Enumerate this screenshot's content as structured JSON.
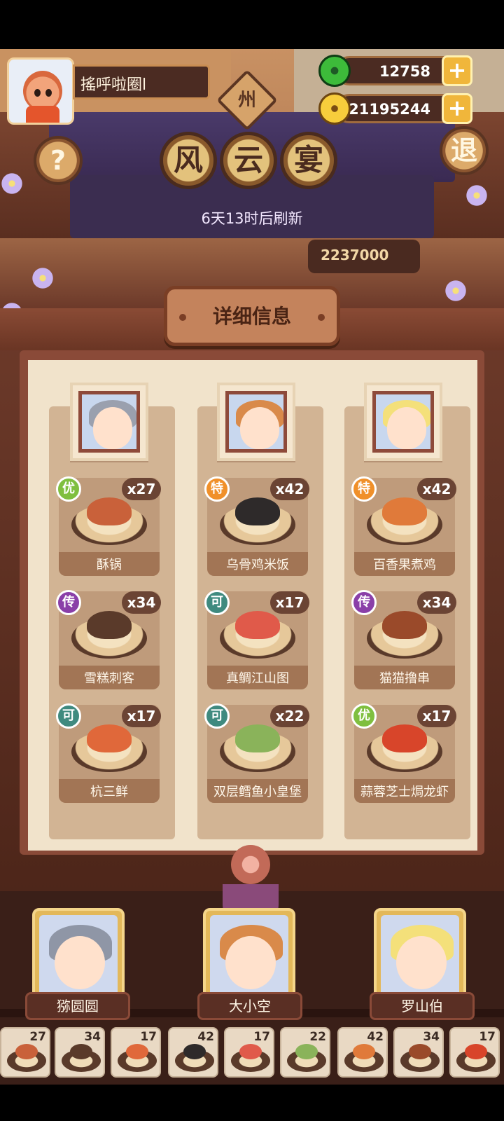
{
  "player": {
    "name": "搖呼啦圈l"
  },
  "region_badge": "州",
  "currencies": {
    "jade": {
      "value": "12758",
      "icon": "jade-icon"
    },
    "coin": {
      "value": "21195244",
      "icon": "coin-icon"
    }
  },
  "buttons": {
    "help": "?",
    "exit": "退",
    "add": "+"
  },
  "event": {
    "title_chars": [
      "风",
      "云",
      "宴"
    ],
    "refresh_text": "6天13时后刷新",
    "score": "2237000"
  },
  "detail_button": "详细信息",
  "columns": [
    {
      "chef": "猕圆圆",
      "dishes": [
        {
          "name": "酥锅",
          "grade": "优",
          "qty": "x27"
        },
        {
          "name": "雪糕刺客",
          "grade": "传",
          "qty": "x34"
        },
        {
          "name": "杭三鲜",
          "grade": "可",
          "qty": "x17"
        }
      ]
    },
    {
      "chef": "大小空",
      "dishes": [
        {
          "name": "乌骨鸡米饭",
          "grade": "特",
          "qty": "x42"
        },
        {
          "name": "真鲷江山图",
          "grade": "可",
          "qty": "x17"
        },
        {
          "name": "双层鳕鱼小皇堡",
          "grade": "可",
          "qty": "x22"
        }
      ]
    },
    {
      "chef": "罗山伯",
      "dishes": [
        {
          "name": "百香果煮鸡",
          "grade": "特",
          "qty": "x42"
        },
        {
          "name": "猫猫撸串",
          "grade": "传",
          "qty": "x34"
        },
        {
          "name": "蒜蓉芝士焗龙虾",
          "grade": "优",
          "qty": "x17"
        }
      ]
    }
  ],
  "dish_slots": [
    "27",
    "34",
    "17",
    "42",
    "17",
    "22",
    "42",
    "34",
    "17"
  ]
}
